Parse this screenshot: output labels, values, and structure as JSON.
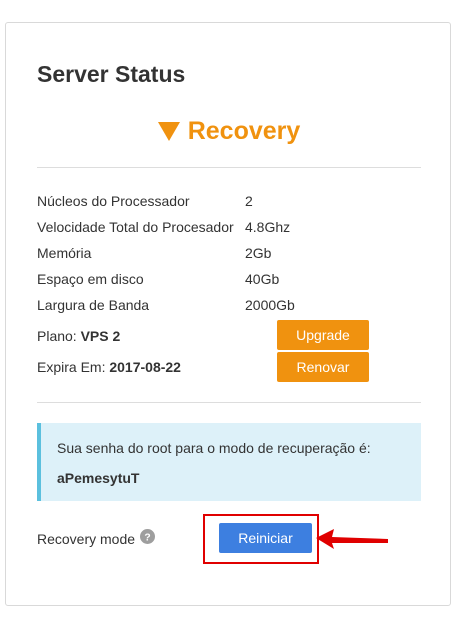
{
  "panel": {
    "title": "Server Status",
    "status": {
      "icon": "triangle-down-icon",
      "label": "Recovery",
      "color": "#f0920f"
    }
  },
  "specs": [
    {
      "label": "Núcleos do Processador",
      "value": "2"
    },
    {
      "label": "Velocidade Total do Procesador",
      "value": "4.8Ghz"
    },
    {
      "label": "Memória",
      "value": "2Gb"
    },
    {
      "label": "Espaço em disco",
      "value": "40Gb"
    },
    {
      "label": "Largura de Banda",
      "value": "2000Gb"
    }
  ],
  "plan": {
    "label": "Plano:",
    "value": "VPS 2",
    "button": "Upgrade"
  },
  "expiry": {
    "label": "Expira Em:",
    "value": "2017-08-22",
    "button": "Renovar"
  },
  "alert": {
    "message": "Sua senha do root para o modo de recuperação é:",
    "password": "aPemesytuT"
  },
  "recovery": {
    "label": "Recovery mode",
    "help_icon": "question-circle-icon",
    "button": "Reiniciar"
  },
  "colors": {
    "accent_orange": "#f0920f",
    "button_blue": "#3d7fe0",
    "alert_bg": "#ddf1f9",
    "alert_border": "#5bc0de",
    "highlight_red": "#e00000"
  }
}
